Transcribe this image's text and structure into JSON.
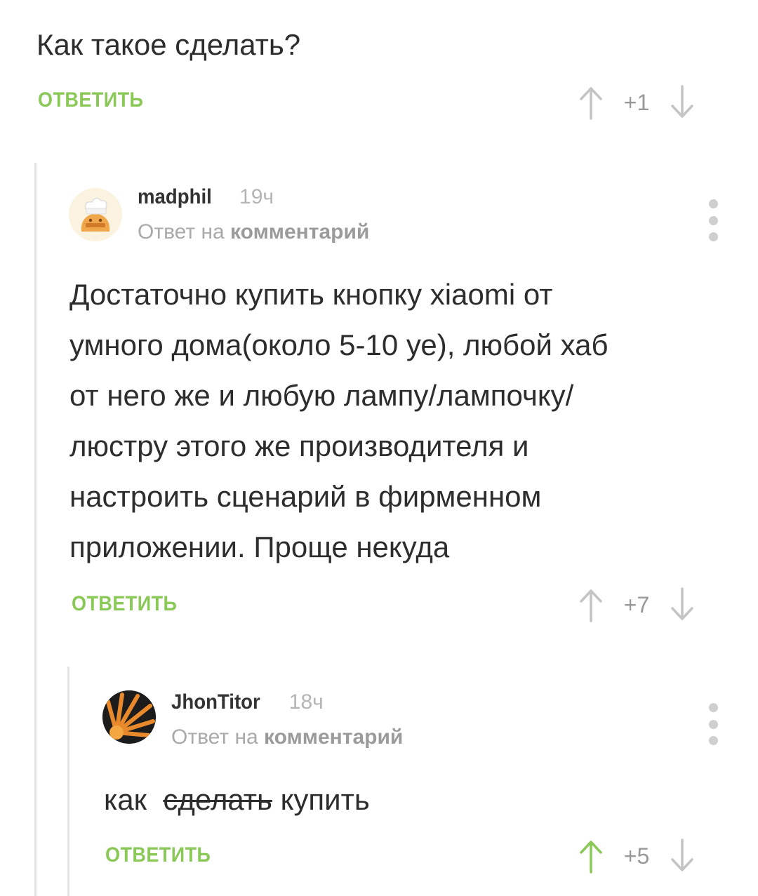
{
  "root_comment": {
    "text": "Как такое сделать?",
    "reply_label": "ОТВЕТИТЬ",
    "score": "+1"
  },
  "comment_1": {
    "username": "madphil",
    "time": "19ч",
    "reply_prefix": "Ответ на",
    "reply_target": "комментарий",
    "text": "Достаточно купить кнопку xiaomi от\nумного дома(около 5-10 уе), любой хаб\nот него же и любую лампу/лампочку/\nлюстру этого же производителя и\nнастроить сценарий в фирменном\nприложении. Проще некуда",
    "reply_label": "ОТВЕТИТЬ",
    "score": "+7"
  },
  "comment_2": {
    "username": "JhonTitor",
    "time": "18ч",
    "reply_prefix": "Ответ на",
    "reply_target": "комментарий",
    "text_before": "как ",
    "text_struck": "сделать",
    "text_after": " купить",
    "reply_label": "ОТВЕТИТЬ",
    "score": "+5",
    "upvoted": true
  },
  "colors": {
    "accent_green": "#8ac858",
    "arrow_gray": "#c4c4c4",
    "text_dark": "#2d2d2d",
    "meta_gray": "#aaaaaa"
  },
  "icons": {
    "upvote": "arrow-up-icon",
    "downvote": "arrow-down-icon",
    "more": "more-vertical-icon"
  }
}
